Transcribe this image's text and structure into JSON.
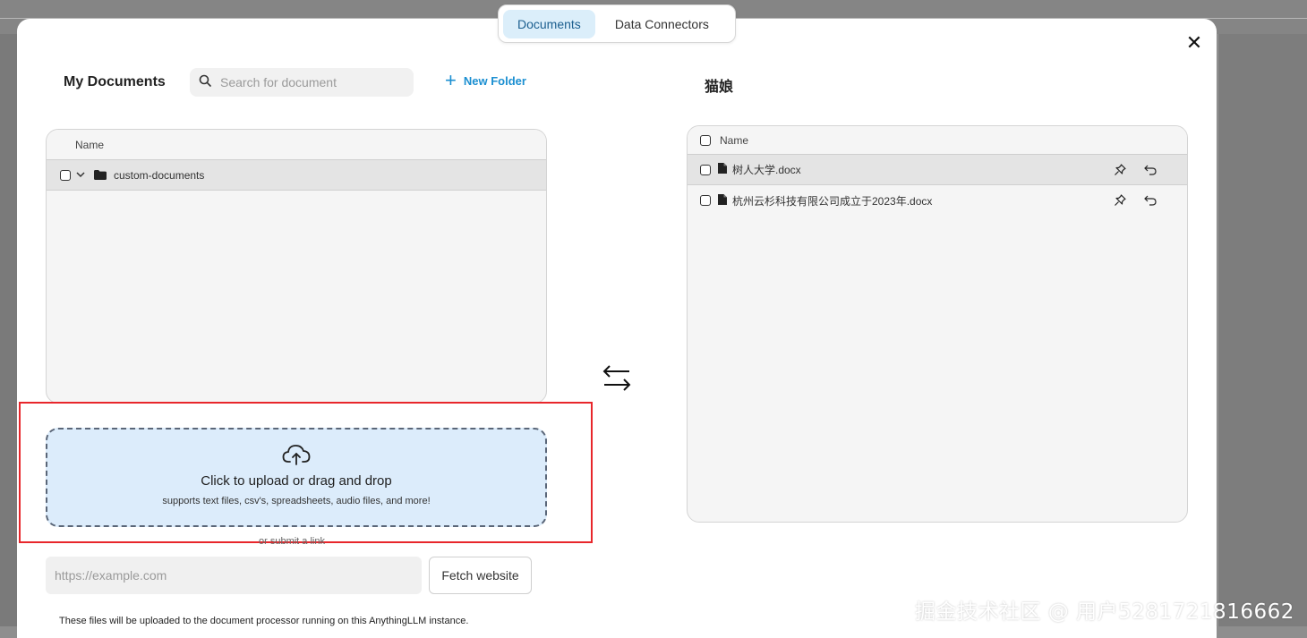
{
  "tabs": [
    {
      "label": "Documents",
      "active": true
    },
    {
      "label": "Data Connectors",
      "active": false
    }
  ],
  "left": {
    "title": "My Documents",
    "search_placeholder": "Search for document",
    "new_folder_label": "New Folder",
    "column_header": "Name",
    "folders": [
      {
        "name": "custom-documents",
        "expanded": true
      }
    ]
  },
  "right": {
    "title": "猫娘",
    "column_header": "Name",
    "files": [
      {
        "name": "树人大学.docx"
      },
      {
        "name": "杭州云杉科技有限公司成立于2023年.docx"
      }
    ]
  },
  "upload": {
    "title": "Click to upload or drag and drop",
    "subtitle": "supports text files, csv's, spreadsheets, audio files, and more!",
    "or_link_text": "or submit a link",
    "url_placeholder": "https://example.com",
    "fetch_label": "Fetch website",
    "footnote": "These files will be uploaded to the document processor running on this AnythingLLM instance."
  },
  "watermark": "掘金技术社区 @ 用户5281721816662",
  "colors": {
    "accent": "#1b8fd1",
    "active_tab_bg": "#dbeefa",
    "dropzone_bg": "#dcecfb",
    "highlight_box": "#e8262b"
  },
  "icons": [
    "search-icon",
    "plus-icon",
    "close-icon",
    "chevron-down-icon",
    "folder-icon",
    "file-icon",
    "pin-icon",
    "undo-icon",
    "swap-arrows-icon",
    "cloud-upload-icon"
  ]
}
